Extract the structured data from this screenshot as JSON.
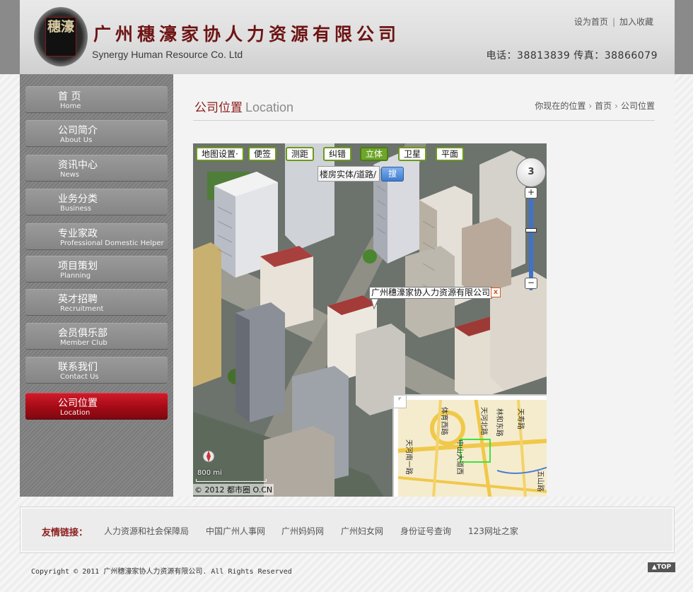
{
  "header": {
    "seal_text": "穗濠",
    "company_name_cn": "广州穗濠家协人力资源有限公司",
    "company_name_en": "Synergy Human Resource Co. Ltd",
    "set_home_label": "设为首页",
    "separator": "|",
    "bookmark_label": "加入收藏",
    "contact_line": "电话：38813839  传真：38866079"
  },
  "nav": {
    "items": [
      {
        "cn": "首 页",
        "en": "Home"
      },
      {
        "cn": "公司简介",
        "en": "About Us"
      },
      {
        "cn": "资讯中心",
        "en": "News"
      },
      {
        "cn": "业务分类",
        "en": "Business"
      },
      {
        "cn": "专业家政",
        "en": "Professional Domestic Helper"
      },
      {
        "cn": "项目策划",
        "en": "Planning"
      },
      {
        "cn": "英才招聘",
        "en": "Recruitment"
      },
      {
        "cn": "会员俱乐部",
        "en": "Member Club"
      },
      {
        "cn": "联系我们",
        "en": "Contact Us"
      },
      {
        "cn": "公司位置",
        "en": "Location",
        "active": true
      }
    ]
  },
  "main": {
    "title_cn": "公司位置",
    "title_en": "Location",
    "breadcrumb": {
      "prefix": "你现在的位置",
      "arrow": "›",
      "home": "首页",
      "current": "公司位置"
    }
  },
  "map": {
    "toolbar": [
      "地图设置·",
      "便签",
      "测距",
      "纠错",
      "立体",
      "卫星",
      "平面"
    ],
    "active_tool": "立体",
    "search_placeholder": "楼房实体/道路/",
    "search_button": "搜",
    "info_label": "广州穗濠家协人力资源有限公司",
    "info_close": "x",
    "zoom_level": "3",
    "zoom_in": "+",
    "zoom_out": "−",
    "scale_label": "800 mi",
    "copyright": "© 2012 都市圈 O.CN",
    "overview_toggle": "⌜",
    "overview_streets": [
      "林和东路",
      "天河北路",
      "体育西路",
      "天河南一路",
      "中山大道西",
      "天寿路",
      "五山路"
    ]
  },
  "footer": {
    "links_label": "友情链接：",
    "links": [
      "人力资源和社会保障局",
      "中国广州人事网",
      "广州妈妈网",
      "广州妇女网",
      "身份证号查询",
      "123网址之家"
    ],
    "copyright": "Copyright © 2011 广州穗濠家协人力资源有限公司. All Rights Reserved",
    "top_button": "▲TOP"
  },
  "colors": {
    "accent_red": "#8b1c1c",
    "nav_active": "#b5101c",
    "map_green": "#6ea52a",
    "zoom_blue": "#3f73c9"
  }
}
